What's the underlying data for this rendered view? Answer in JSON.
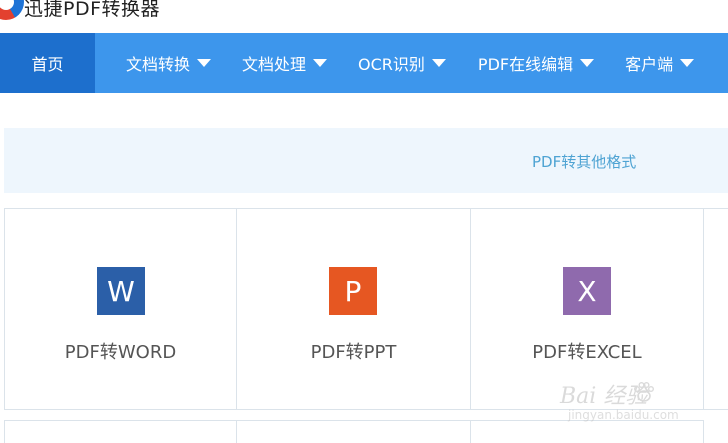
{
  "header": {
    "app_title": "迅捷PDF转换器"
  },
  "nav": {
    "items": [
      {
        "label": "首页",
        "active": true,
        "dropdown": false
      },
      {
        "label": "文档转换",
        "active": false,
        "dropdown": true
      },
      {
        "label": "文档处理",
        "active": false,
        "dropdown": true
      },
      {
        "label": "OCR识别",
        "active": false,
        "dropdown": true
      },
      {
        "label": "PDF在线编辑",
        "active": false,
        "dropdown": true
      },
      {
        "label": "客户端",
        "active": false,
        "dropdown": true
      }
    ]
  },
  "section": {
    "title": "PDF转其他格式"
  },
  "tools": [
    {
      "label": "PDF转WORD",
      "icon_letter": "W",
      "icon": "word-icon",
      "icon_color": "#2b5fa8"
    },
    {
      "label": "PDF转PPT",
      "icon_letter": "P",
      "icon": "powerpoint-icon",
      "icon_color": "#e65722"
    },
    {
      "label": "PDF转EXCEL",
      "icon_letter": "X",
      "icon": "excel-icon",
      "icon_color": "#8f6aad"
    }
  ],
  "watermark": {
    "main": "Bai 经验",
    "sub": "jingyan.baidu.com"
  },
  "colors": {
    "nav_bg": "#3d96ec",
    "nav_active_bg": "#1d6fcd",
    "section_bg": "#eef6fd",
    "section_text": "#4ea3d3"
  }
}
